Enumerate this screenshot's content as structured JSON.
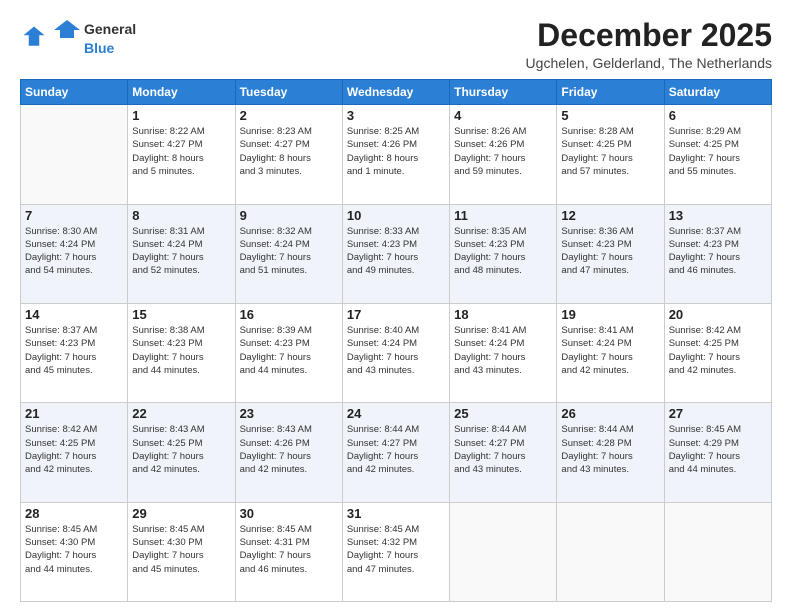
{
  "logo": {
    "general": "General",
    "blue": "Blue"
  },
  "header": {
    "month": "December 2025",
    "location": "Ugchelen, Gelderland, The Netherlands"
  },
  "days_of_week": [
    "Sunday",
    "Monday",
    "Tuesday",
    "Wednesday",
    "Thursday",
    "Friday",
    "Saturday"
  ],
  "weeks": [
    [
      {
        "day": "",
        "info": ""
      },
      {
        "day": "1",
        "info": "Sunrise: 8:22 AM\nSunset: 4:27 PM\nDaylight: 8 hours\nand 5 minutes."
      },
      {
        "day": "2",
        "info": "Sunrise: 8:23 AM\nSunset: 4:27 PM\nDaylight: 8 hours\nand 3 minutes."
      },
      {
        "day": "3",
        "info": "Sunrise: 8:25 AM\nSunset: 4:26 PM\nDaylight: 8 hours\nand 1 minute."
      },
      {
        "day": "4",
        "info": "Sunrise: 8:26 AM\nSunset: 4:26 PM\nDaylight: 7 hours\nand 59 minutes."
      },
      {
        "day": "5",
        "info": "Sunrise: 8:28 AM\nSunset: 4:25 PM\nDaylight: 7 hours\nand 57 minutes."
      },
      {
        "day": "6",
        "info": "Sunrise: 8:29 AM\nSunset: 4:25 PM\nDaylight: 7 hours\nand 55 minutes."
      }
    ],
    [
      {
        "day": "7",
        "info": "Sunrise: 8:30 AM\nSunset: 4:24 PM\nDaylight: 7 hours\nand 54 minutes."
      },
      {
        "day": "8",
        "info": "Sunrise: 8:31 AM\nSunset: 4:24 PM\nDaylight: 7 hours\nand 52 minutes."
      },
      {
        "day": "9",
        "info": "Sunrise: 8:32 AM\nSunset: 4:24 PM\nDaylight: 7 hours\nand 51 minutes."
      },
      {
        "day": "10",
        "info": "Sunrise: 8:33 AM\nSunset: 4:23 PM\nDaylight: 7 hours\nand 49 minutes."
      },
      {
        "day": "11",
        "info": "Sunrise: 8:35 AM\nSunset: 4:23 PM\nDaylight: 7 hours\nand 48 minutes."
      },
      {
        "day": "12",
        "info": "Sunrise: 8:36 AM\nSunset: 4:23 PM\nDaylight: 7 hours\nand 47 minutes."
      },
      {
        "day": "13",
        "info": "Sunrise: 8:37 AM\nSunset: 4:23 PM\nDaylight: 7 hours\nand 46 minutes."
      }
    ],
    [
      {
        "day": "14",
        "info": "Sunrise: 8:37 AM\nSunset: 4:23 PM\nDaylight: 7 hours\nand 45 minutes."
      },
      {
        "day": "15",
        "info": "Sunrise: 8:38 AM\nSunset: 4:23 PM\nDaylight: 7 hours\nand 44 minutes."
      },
      {
        "day": "16",
        "info": "Sunrise: 8:39 AM\nSunset: 4:23 PM\nDaylight: 7 hours\nand 44 minutes."
      },
      {
        "day": "17",
        "info": "Sunrise: 8:40 AM\nSunset: 4:24 PM\nDaylight: 7 hours\nand 43 minutes."
      },
      {
        "day": "18",
        "info": "Sunrise: 8:41 AM\nSunset: 4:24 PM\nDaylight: 7 hours\nand 43 minutes."
      },
      {
        "day": "19",
        "info": "Sunrise: 8:41 AM\nSunset: 4:24 PM\nDaylight: 7 hours\nand 42 minutes."
      },
      {
        "day": "20",
        "info": "Sunrise: 8:42 AM\nSunset: 4:25 PM\nDaylight: 7 hours\nand 42 minutes."
      }
    ],
    [
      {
        "day": "21",
        "info": "Sunrise: 8:42 AM\nSunset: 4:25 PM\nDaylight: 7 hours\nand 42 minutes."
      },
      {
        "day": "22",
        "info": "Sunrise: 8:43 AM\nSunset: 4:25 PM\nDaylight: 7 hours\nand 42 minutes."
      },
      {
        "day": "23",
        "info": "Sunrise: 8:43 AM\nSunset: 4:26 PM\nDaylight: 7 hours\nand 42 minutes."
      },
      {
        "day": "24",
        "info": "Sunrise: 8:44 AM\nSunset: 4:27 PM\nDaylight: 7 hours\nand 42 minutes."
      },
      {
        "day": "25",
        "info": "Sunrise: 8:44 AM\nSunset: 4:27 PM\nDaylight: 7 hours\nand 43 minutes."
      },
      {
        "day": "26",
        "info": "Sunrise: 8:44 AM\nSunset: 4:28 PM\nDaylight: 7 hours\nand 43 minutes."
      },
      {
        "day": "27",
        "info": "Sunrise: 8:45 AM\nSunset: 4:29 PM\nDaylight: 7 hours\nand 44 minutes."
      }
    ],
    [
      {
        "day": "28",
        "info": "Sunrise: 8:45 AM\nSunset: 4:30 PM\nDaylight: 7 hours\nand 44 minutes."
      },
      {
        "day": "29",
        "info": "Sunrise: 8:45 AM\nSunset: 4:30 PM\nDaylight: 7 hours\nand 45 minutes."
      },
      {
        "day": "30",
        "info": "Sunrise: 8:45 AM\nSunset: 4:31 PM\nDaylight: 7 hours\nand 46 minutes."
      },
      {
        "day": "31",
        "info": "Sunrise: 8:45 AM\nSunset: 4:32 PM\nDaylight: 7 hours\nand 47 minutes."
      },
      {
        "day": "",
        "info": ""
      },
      {
        "day": "",
        "info": ""
      },
      {
        "day": "",
        "info": ""
      }
    ]
  ]
}
